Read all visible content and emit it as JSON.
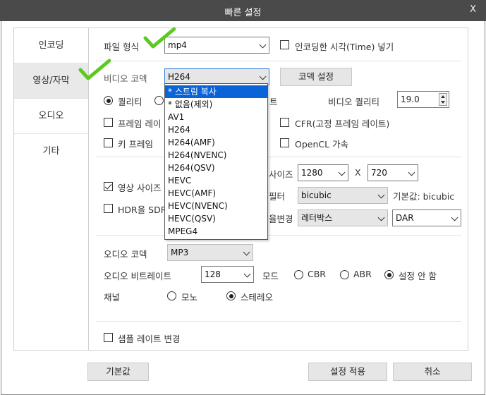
{
  "window": {
    "title": "빠른 설정",
    "close_label": "X"
  },
  "tabs": [
    {
      "label": "인코딩",
      "active": false
    },
    {
      "label": "영상/자막",
      "active": true
    },
    {
      "label": "오디오",
      "active": false
    },
    {
      "label": "기타",
      "active": false
    }
  ],
  "file_format": {
    "label": "파일 형식",
    "value": "mp4"
  },
  "insert_time": {
    "label": "인코딩한 시각(Time) 넣기",
    "checked": false
  },
  "video_codec": {
    "label": "비디오 코덱",
    "value": "H264"
  },
  "codec_settings_button": "코덱 설정",
  "quality_radio": {
    "label": "퀄리티",
    "checked": true
  },
  "bitrate_radio_fragment": "트",
  "video_quality": {
    "label": "비디오 퀄리티",
    "value": "19.0"
  },
  "frame_rate_check": {
    "label": "프레임 레이",
    "checked": false
  },
  "cfr_check": {
    "label": "CFR(고정 프레임 레이트)",
    "checked": false
  },
  "keyframe_check": {
    "label": "키 프레임",
    "checked": false
  },
  "opencl_check": {
    "label": "OpenCL 가속",
    "checked": false
  },
  "resize_check": {
    "label": "영상 사이즈",
    "checked": true
  },
  "size": {
    "label_fragment": "사이즈",
    "width": "1280",
    "separator": "X",
    "height": "720"
  },
  "filter": {
    "label_fragment": "필터",
    "value": "bicubic",
    "default_text": "기본값: bicubic"
  },
  "hdr_check": {
    "label": "HDR을 SDR",
    "checked": false
  },
  "aspect": {
    "label_fragment": "율변경",
    "mode": "레터박스",
    "ratio": "DAR"
  },
  "codec_options": [
    "* 스트림 복사",
    "* 없음(제외)",
    "AV1",
    "H264",
    "H264(AMF)",
    "H264(NVENC)",
    "H264(QSV)",
    "HEVC",
    "HEVC(AMF)",
    "HEVC(NVENC)",
    "HEVC(QSV)",
    "MPEG4"
  ],
  "codec_selected_index": 0,
  "audio_codec": {
    "label": "오디오 코덱",
    "value": "MP3"
  },
  "audio_bitrate": {
    "label": "오디오 비트레이트",
    "value": "128"
  },
  "audio_mode": {
    "label": "모드",
    "options": [
      "CBR",
      "ABR",
      "설정 안 함"
    ],
    "selected_index": 2
  },
  "channel": {
    "label": "채널",
    "options": [
      "모노",
      "스테레오"
    ],
    "selected_index": 1
  },
  "sample_rate_check": {
    "label": "샘플 레이트 변경",
    "checked": false
  },
  "buttons": {
    "default": "기본값",
    "apply": "설정 적용",
    "cancel": "취소"
  },
  "colors": {
    "titlebar": "#4a4a4a",
    "selection": "#0a64d8",
    "checkmark": "#5cc91e"
  },
  "icons": [
    "check-mark-icon",
    "chevron-down-icon"
  ]
}
